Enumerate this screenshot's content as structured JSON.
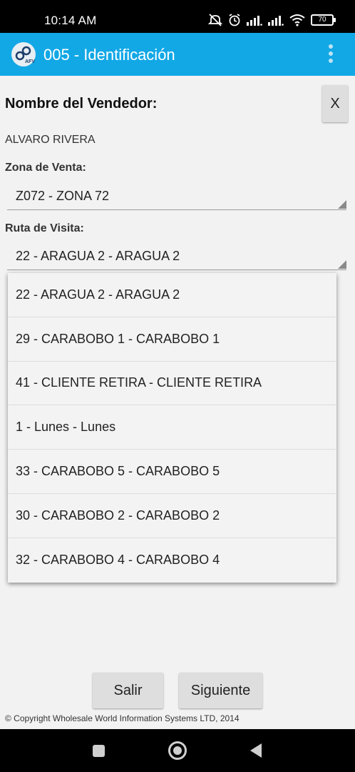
{
  "status_bar": {
    "time": "10:14 AM",
    "battery": "70"
  },
  "app_bar": {
    "title": "005 - Identificación"
  },
  "vendor": {
    "title": "Nombre del Vendedor:",
    "close_label": "X",
    "name": "ALVARO RIVERA"
  },
  "zona": {
    "label": "Zona de Venta:",
    "value": "Z072 - ZONA 72"
  },
  "ruta": {
    "label": "Ruta de Visita:",
    "value": "22 - ARAGUA 2 - ARAGUA 2",
    "options": [
      "22 - ARAGUA 2 - ARAGUA 2",
      "29 - CARABOBO 1 - CARABOBO 1",
      "41 - CLIENTE RETIRA - CLIENTE RETIRA",
      "1 - Lunes - Lunes",
      "33 - CARABOBO 5 - CARABOBO 5",
      "30 - CARABOBO 2 - CARABOBO 2",
      "32 - CARABOBO 4 - CARABOBO 4"
    ]
  },
  "buttons": {
    "exit_label": "Salir",
    "next_label": "Siguiente"
  },
  "footer": {
    "copyright": "© Copyright Wholesale World Information Systems LTD, 2014"
  },
  "colors": {
    "app_bar": "#12a8e6",
    "background": "#f2f2f2",
    "button": "#dedede"
  }
}
